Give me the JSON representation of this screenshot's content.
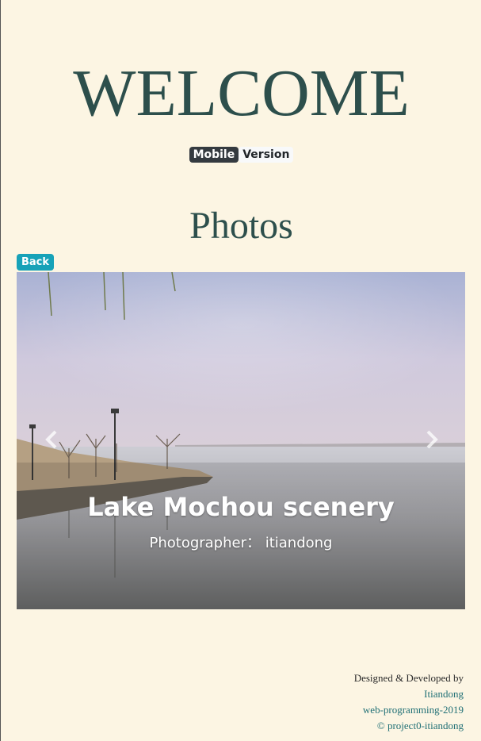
{
  "header": {
    "welcome": "WELCOME",
    "version_badge": "Mobile",
    "version_text": "Version"
  },
  "main": {
    "title": "Photos",
    "back_label": "Back",
    "carousel": {
      "prev_icon": "chevron-left-icon",
      "next_icon": "chevron-right-icon",
      "slide": {
        "title": "Lake Mochou scenery",
        "subtitle": "Photographer： itiandong"
      }
    }
  },
  "footer": {
    "credit": "Designed & Developed by",
    "author": "Itiandong",
    "course": "web-programming-2019",
    "project": "© project0-itiandong"
  },
  "colors": {
    "background": "#fcf5e3",
    "heading": "#2d4f4c",
    "back_button": "#17a2b8",
    "badge_dark": "#343a40",
    "link": "#1f6f75"
  }
}
